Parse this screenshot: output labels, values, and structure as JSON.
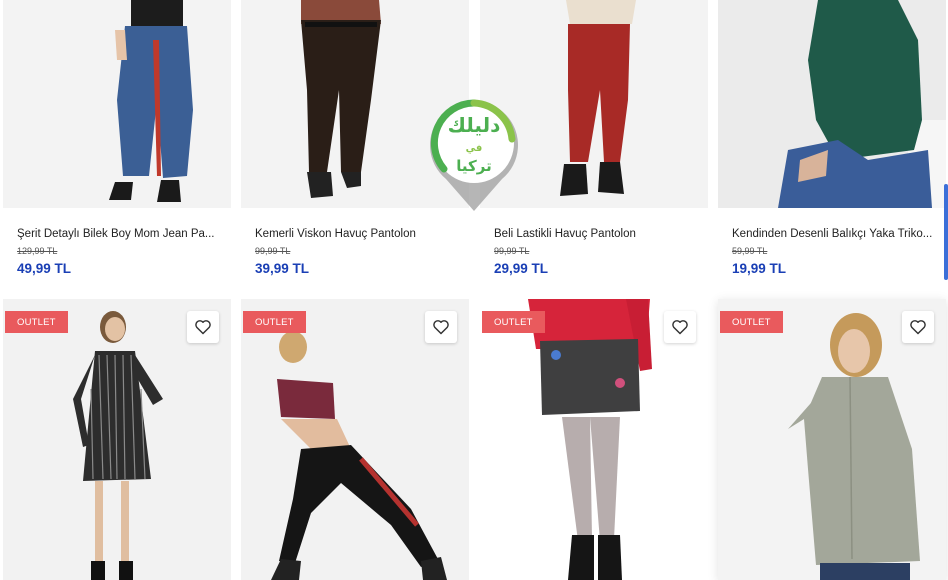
{
  "products_top": [
    {
      "name": "Şerit Detaylı Bilek Boy Mom Jean Pa...",
      "old_price": "129,99 TL",
      "price": "49,99 TL"
    },
    {
      "name": "Kemerli Viskon Havuç Pantolon",
      "old_price": "99,99 TL",
      "price": "39,99 TL"
    },
    {
      "name": "Beli Lastikli Havuç Pantolon",
      "old_price": "99,99 TL",
      "price": "29,99 TL"
    },
    {
      "name": "Kendinden Desenli Balıkçı Yaka Triko...",
      "old_price": "59,99 TL",
      "price": "19,99 TL"
    }
  ],
  "products_bottom": [
    {
      "badge": "OUTLET",
      "favorite_icon": "heart-icon"
    },
    {
      "badge": "OUTLET",
      "favorite_icon": "heart-icon"
    },
    {
      "badge": "OUTLET",
      "favorite_icon": "heart-icon"
    },
    {
      "badge": "OUTLET",
      "favorite_icon": "heart-icon"
    }
  ],
  "watermark": {
    "line1": "دليلك",
    "line2": "في",
    "line3": "تركيا"
  },
  "colors": {
    "price": "#1a3fb5",
    "badge": "#e95a5d",
    "watermark": "#4caf50"
  }
}
